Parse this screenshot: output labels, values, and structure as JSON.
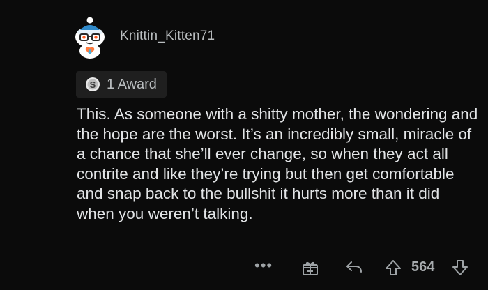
{
  "comment": {
    "username": "Knittin_Kitten71",
    "award_label": "1 Award",
    "body": "This. As someone with a shitty mother, the wondering and the hope are the worst. It’s an incredibly small, miracle of a chance that she’ll ever change, so when they act all contrite and like they’re trying but then get comfortable and snap back to the bullshit it hurts more than it did when you weren’t talking.",
    "more_label": "•••",
    "score": "564"
  },
  "icons": {
    "avatar": "snoo-avatar-icon",
    "award": "silver-award-icon",
    "give_award": "gift-box-icon",
    "reply": "reply-arrow-icon",
    "upvote": "upvote-arrow-icon",
    "downvote": "downvote-arrow-icon"
  },
  "colors": {
    "background": "#0b0b0b",
    "text": "#e2e4e6",
    "muted": "#9ea3a6",
    "pill": "#1f1f1f",
    "accent_blue": "#2f89c9"
  }
}
